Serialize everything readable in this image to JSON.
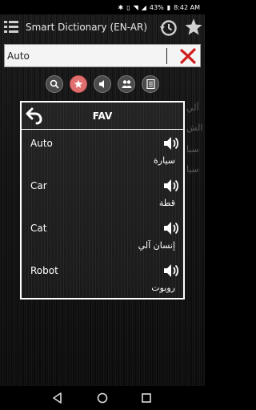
{
  "status_bar": {
    "battery": "43%",
    "time": "8:42 AM"
  },
  "app_bar": {
    "title": "Smart Dictionary (EN-AR)",
    "icons": [
      "menu-icon",
      "history-icon",
      "star-icon"
    ]
  },
  "search": {
    "value": "Auto",
    "clear_icon": "clear-x-icon"
  },
  "modes": {
    "buttons": [
      {
        "icon": "search-icon",
        "active": false
      },
      {
        "icon": "star-icon",
        "active": true
      },
      {
        "icon": "speaker-icon",
        "active": false
      },
      {
        "icon": "people-icon",
        "active": false
      },
      {
        "icon": "list-icon",
        "active": false
      }
    ],
    "active_color": "#e06f6f"
  },
  "background_words": [
    "آلي",
    "الش",
    "سيا",
    "سيا"
  ],
  "dialog": {
    "title": "FAV",
    "entries": [
      {
        "word": "Auto",
        "translation": "سيارة"
      },
      {
        "word": "Car",
        "translation": "قطة"
      },
      {
        "word": "Cat",
        "translation": "إنسان آلي"
      },
      {
        "word": "Robot",
        "translation": "روبوت"
      }
    ]
  },
  "nav_bar": {
    "icons": [
      "back-triangle-icon",
      "home-circle-icon",
      "recents-square-icon"
    ]
  }
}
